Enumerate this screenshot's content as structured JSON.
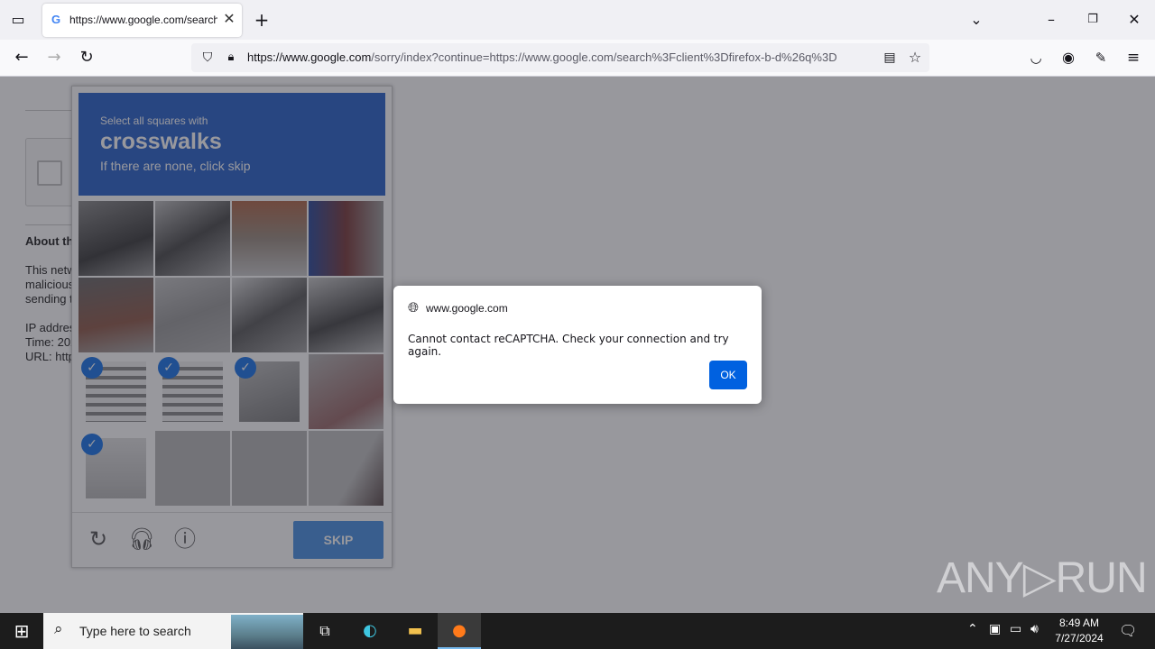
{
  "browser": {
    "tab_title": "https://www.google.com/search",
    "url_domain": "https://www.google.com",
    "url_rest": "/sorry/index?continue=https://www.google.com/search%3Fclient%3Dfirefox-b-d%26q%3D"
  },
  "page": {
    "about_heading": "About th",
    "para_lines": [
      "This netw",
      "malicious",
      "sending t"
    ],
    "ip_line": "IP addres",
    "time_line": "Time: 202",
    "url_line": "URL: http"
  },
  "captcha": {
    "instruction": "Select all squares with",
    "target": "crosswalks",
    "hint": "If there are none, click skip",
    "skip_label": "SKIP"
  },
  "dialog": {
    "origin": "www.google.com",
    "message": "Cannot contact reCAPTCHA. Check your connection and try again.",
    "ok_label": "OK"
  },
  "watermark": "ANY▷RUN",
  "taskbar": {
    "search_placeholder": "Type here to search",
    "time": "8:49 AM",
    "date": "7/27/2024"
  }
}
